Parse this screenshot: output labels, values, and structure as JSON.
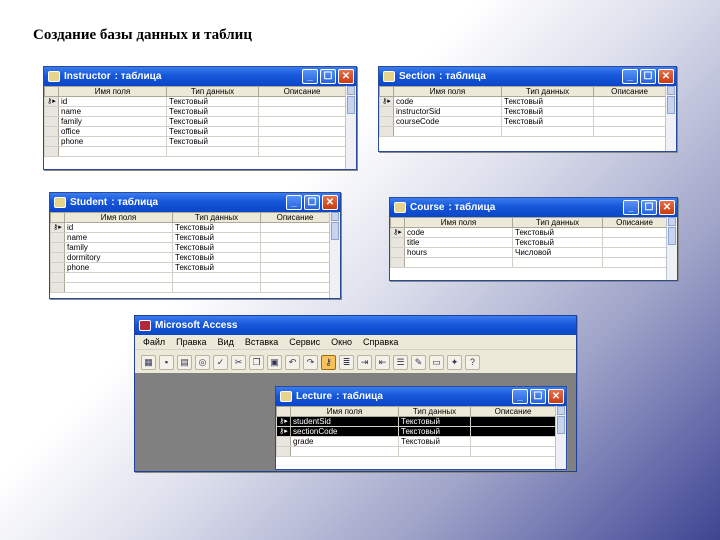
{
  "slide": {
    "title": "Создание базы данных и таблиц"
  },
  "common": {
    "title_suffix": " : таблица",
    "headers": [
      "Имя поля",
      "Тип данных",
      "Описание"
    ],
    "key_marker": "⚷▸",
    "minimize": "_",
    "maximize": "☐",
    "close": "✕"
  },
  "windows": {
    "instructor": {
      "name": "Instructor",
      "rows": [
        [
          "id",
          "Текстовый",
          ""
        ],
        [
          "name",
          "Текстовый",
          ""
        ],
        [
          "family",
          "Текстовый",
          ""
        ],
        [
          "office",
          "Текстовый",
          ""
        ],
        [
          "phone",
          "Текстовый",
          ""
        ]
      ]
    },
    "section": {
      "name": "Section",
      "rows": [
        [
          "code",
          "Текстовый",
          ""
        ],
        [
          "instructorSid",
          "Текстовый",
          ""
        ],
        [
          "courseCode",
          "Текстовый",
          ""
        ]
      ]
    },
    "student": {
      "name": "Student",
      "rows": [
        [
          "id",
          "Текстовый",
          ""
        ],
        [
          "name",
          "Текстовый",
          ""
        ],
        [
          "family",
          "Текстовый",
          ""
        ],
        [
          "dormitory",
          "Текстовый",
          ""
        ],
        [
          "phone",
          "Текстовый",
          ""
        ]
      ]
    },
    "course": {
      "name": "Course",
      "rows": [
        [
          "code",
          "Текстовый",
          ""
        ],
        [
          "title",
          "Текстовый",
          ""
        ],
        [
          "hours",
          "Числовой",
          ""
        ]
      ]
    },
    "lecture": {
      "name": "Lecture",
      "rows": [
        [
          "studentSid",
          "Текстовый",
          ""
        ],
        [
          "sectionCode",
          "Текстовый",
          ""
        ],
        [
          "grade",
          "Текстовый",
          ""
        ]
      ]
    }
  },
  "access": {
    "title": "Microsoft Access",
    "menu": [
      "Файл",
      "Правка",
      "Вид",
      "Вставка",
      "Сервис",
      "Окно",
      "Справка"
    ]
  }
}
